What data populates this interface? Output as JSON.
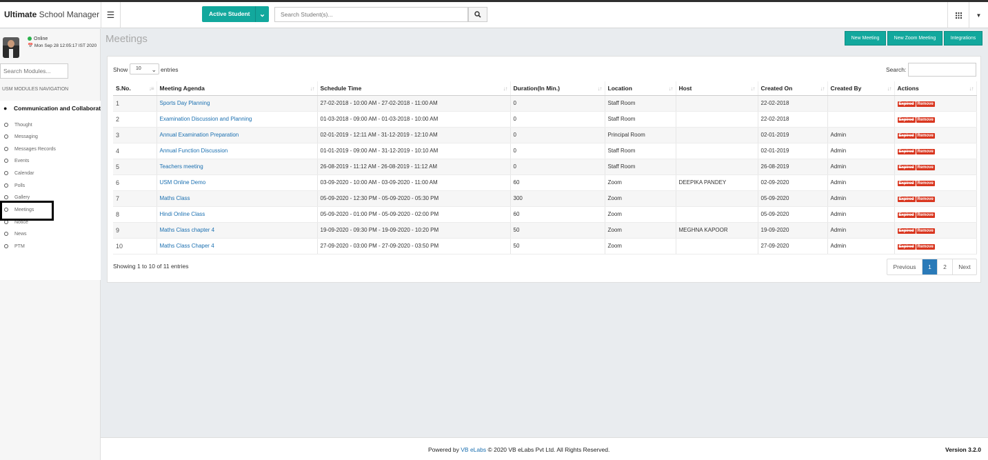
{
  "brand": {
    "bold": "Ultimate",
    "rest": " School Manager"
  },
  "header": {
    "menu_icon": "hamburger-icon",
    "active_select": "Active Student",
    "search_placeholder": "Search Student(s)...",
    "search_icon": "search-icon",
    "apps_icon": "grid-icon",
    "caret_icon": "caret-down-icon"
  },
  "sidebar": {
    "status": "Online",
    "datetime": "Mon Sep 28 12:05:17 IST 2020",
    "search_placeholder": "Search Modules...",
    "nav_title": "USM MODULES NAVIGATION",
    "module": "Communication and Collaborat",
    "items": [
      "Thought",
      "Messaging",
      "Messages Records",
      "Events",
      "Calendar",
      "Polls",
      "Gallery",
      "Meetings",
      "Notice",
      "News",
      "PTM"
    ],
    "selected": "Meetings"
  },
  "page": {
    "title": "Meetings",
    "buttons": {
      "new_meeting": "New Meeting",
      "new_zoom": "New Zoom Meeting",
      "integrations": "Integrations"
    }
  },
  "table_controls": {
    "show": "Show",
    "length": "10",
    "entries": "entries",
    "search_label": "Search:"
  },
  "table": {
    "columns": [
      "S.No.",
      "Meeting Agenda",
      "Schedule Time",
      "Duration(In Min.)",
      "Location",
      "Host",
      "Created On",
      "Created By",
      "Actions"
    ],
    "rows": [
      {
        "sn": "1",
        "agenda": "Sports Day Planning",
        "schedule": "27-02-2018 - 10:00 AM - 27-02-2018 - 11:00 AM",
        "duration": "0",
        "location": "Staff Room",
        "host": "",
        "created_on": "22-02-2018",
        "created_by": ""
      },
      {
        "sn": "2",
        "agenda": "Examination Discussion and Planning",
        "schedule": "01-03-2018 - 09:00 AM - 01-03-2018 - 10:00 AM",
        "duration": "0",
        "location": "Staff Room",
        "host": "",
        "created_on": "22-02-2018",
        "created_by": ""
      },
      {
        "sn": "3",
        "agenda": "Annual Examination Preparation",
        "schedule": "02-01-2019 - 12:11 AM - 31-12-2019 - 12:10 AM",
        "duration": "0",
        "location": "Principal Room",
        "host": "",
        "created_on": "02-01-2019",
        "created_by": "Admin"
      },
      {
        "sn": "4",
        "agenda": "Annual Function Discussion",
        "schedule": "01-01-2019 - 09:00 AM - 31-12-2019 - 10:10 AM",
        "duration": "0",
        "location": "Staff Room",
        "host": "",
        "created_on": "02-01-2019",
        "created_by": "Admin"
      },
      {
        "sn": "5",
        "agenda": "Teachers meeting",
        "schedule": "26-08-2019 - 11:12 AM - 26-08-2019 - 11:12 AM",
        "duration": "0",
        "location": "Staff Room",
        "host": "",
        "created_on": "26-08-2019",
        "created_by": "Admin"
      },
      {
        "sn": "6",
        "agenda": "USM Online Demo",
        "schedule": "03-09-2020 - 10:00 AM - 03-09-2020 - 11:00 AM",
        "duration": "60",
        "location": "Zoom",
        "host": "DEEPIKA PANDEY",
        "created_on": "02-09-2020",
        "created_by": "Admin"
      },
      {
        "sn": "7",
        "agenda": "Maths Class",
        "schedule": "05-09-2020 - 12:30 PM - 05-09-2020 - 05:30 PM",
        "duration": "300",
        "location": "Zoom",
        "host": "",
        "created_on": "05-09-2020",
        "created_by": "Admin"
      },
      {
        "sn": "8",
        "agenda": "Hindi Online Class",
        "schedule": "05-09-2020 - 01:00 PM - 05-09-2020 - 02:00 PM",
        "duration": "60",
        "location": "Zoom",
        "host": "",
        "created_on": "05-09-2020",
        "created_by": "Admin"
      },
      {
        "sn": "9",
        "agenda": "Maths Class chapter 4",
        "schedule": "19-09-2020 - 09:30 PM - 19-09-2020 - 10:20 PM",
        "duration": "50",
        "location": "Zoom",
        "host": "MEGHNA KAPOOR",
        "created_on": "19-09-2020",
        "created_by": "Admin"
      },
      {
        "sn": "10",
        "agenda": "Maths Class Chaper 4",
        "schedule": "27-09-2020 - 03:00 PM - 27-09-2020 - 03:50 PM",
        "duration": "50",
        "location": "Zoom",
        "host": "",
        "created_on": "27-09-2020",
        "created_by": "Admin"
      }
    ],
    "action_expired": "Expired",
    "action_remove": "Remove"
  },
  "pagination": {
    "info": "Showing 1 to 10 of 11 entries",
    "previous": "Previous",
    "pages": [
      "1",
      "2"
    ],
    "current": "1",
    "next": "Next"
  },
  "footer": {
    "powered": "Powered by ",
    "company_link": "VB eLabs",
    "rest": " © 2020 VB eLabs Pvt Ltd. All Rights Reserved.",
    "version": "Version 3.2.0"
  },
  "colors": {
    "accent": "#12a89d",
    "link": "#1a6fb0",
    "danger": "#d9361f",
    "page_active": "#2a7ab8"
  }
}
